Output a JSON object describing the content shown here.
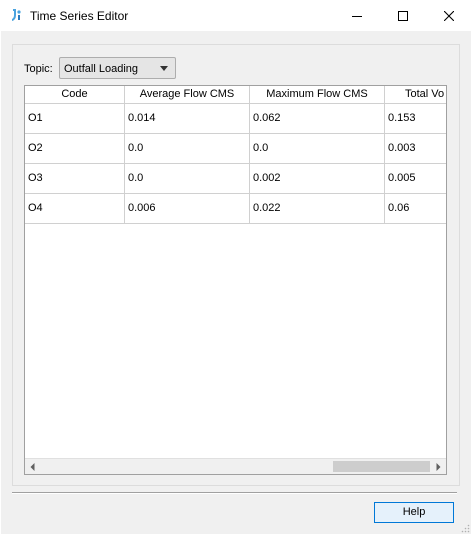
{
  "window": {
    "title": "Time Series Editor",
    "icon": "app-logo-icon",
    "controls": [
      "minimize-icon",
      "maximize-icon",
      "close-icon"
    ]
  },
  "topic": {
    "label": "Topic:",
    "selected": "Outfall Loading"
  },
  "table": {
    "columns": [
      "Code",
      "Average Flow CMS",
      "Maximum Flow CMS",
      "Total Vo"
    ],
    "rows": [
      [
        "O1",
        "0.014",
        "0.062",
        "0.153"
      ],
      [
        "O2",
        "0.0",
        "0.0",
        "0.003"
      ],
      [
        "O3",
        "0.0",
        "0.002",
        "0.005"
      ],
      [
        "O4",
        "0.006",
        "0.022",
        "0.06"
      ]
    ]
  },
  "footer": {
    "help_label": "Help"
  },
  "colors": {
    "accent": "#0078d7",
    "app_icon": "#4aa3df",
    "client_bg": "#f0f0f0"
  }
}
